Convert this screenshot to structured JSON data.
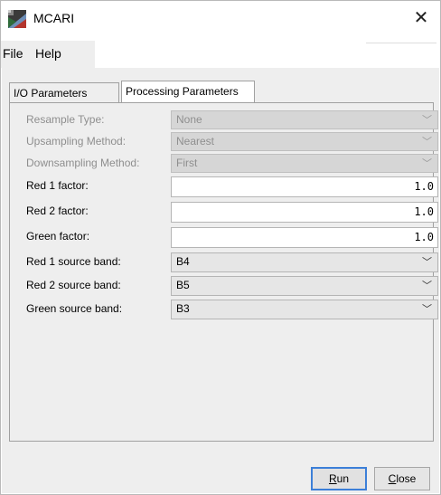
{
  "window": {
    "title": "MCARI"
  },
  "menu": {
    "items": [
      "File",
      "Help"
    ]
  },
  "tabs": [
    {
      "label": "I/O Parameters",
      "active": false
    },
    {
      "label": "Processing Parameters",
      "active": true
    }
  ],
  "params": {
    "resample_type": {
      "label": "Resample Type:",
      "value": "None",
      "enabled": false
    },
    "upsampling_method": {
      "label": "Upsampling Method:",
      "value": "Nearest",
      "enabled": false
    },
    "downsampling_method": {
      "label": "Downsampling Method:",
      "value": "First",
      "enabled": false
    },
    "red1_factor": {
      "label": "Red 1 factor:",
      "value": "1.0"
    },
    "red2_factor": {
      "label": "Red 2 factor:",
      "value": "1.0"
    },
    "green_factor": {
      "label": "Green factor:",
      "value": "1.0"
    },
    "red1_source_band": {
      "label": "Red 1 source band:",
      "value": "B4"
    },
    "red2_source_band": {
      "label": "Red 2 source band:",
      "value": "B5"
    },
    "green_source_band": {
      "label": "Green source band:",
      "value": "B3"
    }
  },
  "buttons": {
    "run": {
      "mnemonic": "R",
      "rest": "un"
    },
    "close": {
      "mnemonic": "C",
      "rest": "lose"
    }
  },
  "icons": {
    "dropdown": "chevron-down-icon",
    "app": "mcari-app-icon",
    "close": "close-icon"
  }
}
